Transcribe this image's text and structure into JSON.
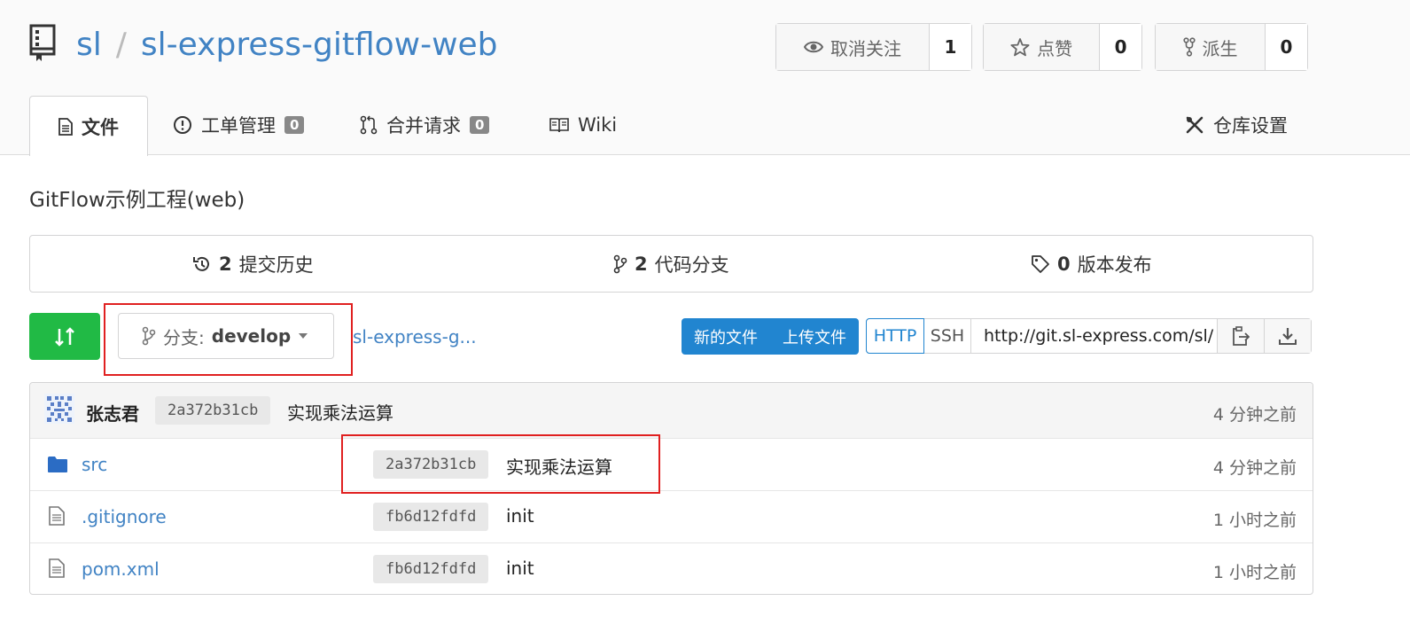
{
  "header": {
    "owner": "sl",
    "separator": "/",
    "repo": "sl-express-gitflow-web",
    "watch": {
      "label": "取消关注",
      "count": "1"
    },
    "star": {
      "label": "点赞",
      "count": "0"
    },
    "fork": {
      "label": "派生",
      "count": "0"
    }
  },
  "tabs": [
    {
      "label": "文件"
    },
    {
      "label": "工单管理",
      "badge": "0"
    },
    {
      "label": "合并请求",
      "badge": "0"
    },
    {
      "label": "Wiki"
    },
    {
      "label": "仓库设置"
    }
  ],
  "description": "GitFlow示例工程(web)",
  "stats": {
    "commits": {
      "count": "2",
      "label": "提交历史"
    },
    "branches": {
      "count": "2",
      "label": "代码分支"
    },
    "releases": {
      "count": "0",
      "label": "版本发布"
    }
  },
  "toolbar": {
    "branch_prefix": "分支:",
    "branch_name": "develop",
    "breadcrumb": "sl-express-g...",
    "new_file": "新的文件",
    "upload_file": "上传文件",
    "http": "HTTP",
    "ssh": "SSH",
    "clone_url": "http://git.sl-express.com/sl/"
  },
  "latest_commit": {
    "author": "张志君",
    "sha": "2a372b31cb",
    "message": "实现乘法运算",
    "time": "4 分钟之前"
  },
  "files": [
    {
      "name": "src",
      "type": "folder",
      "sha": "2a372b31cb",
      "message": "实现乘法运算",
      "time": "4 分钟之前"
    },
    {
      "name": ".gitignore",
      "type": "file",
      "sha": "fb6d12fdfd",
      "message": "init",
      "time": "1 小时之前"
    },
    {
      "name": "pom.xml",
      "type": "file",
      "sha": "fb6d12fdfd",
      "message": "init",
      "time": "1 小时之前"
    }
  ],
  "colors": {
    "link": "#4183c4",
    "primary": "#2185d0",
    "success": "#21ba45",
    "highlight": "#e02020"
  }
}
